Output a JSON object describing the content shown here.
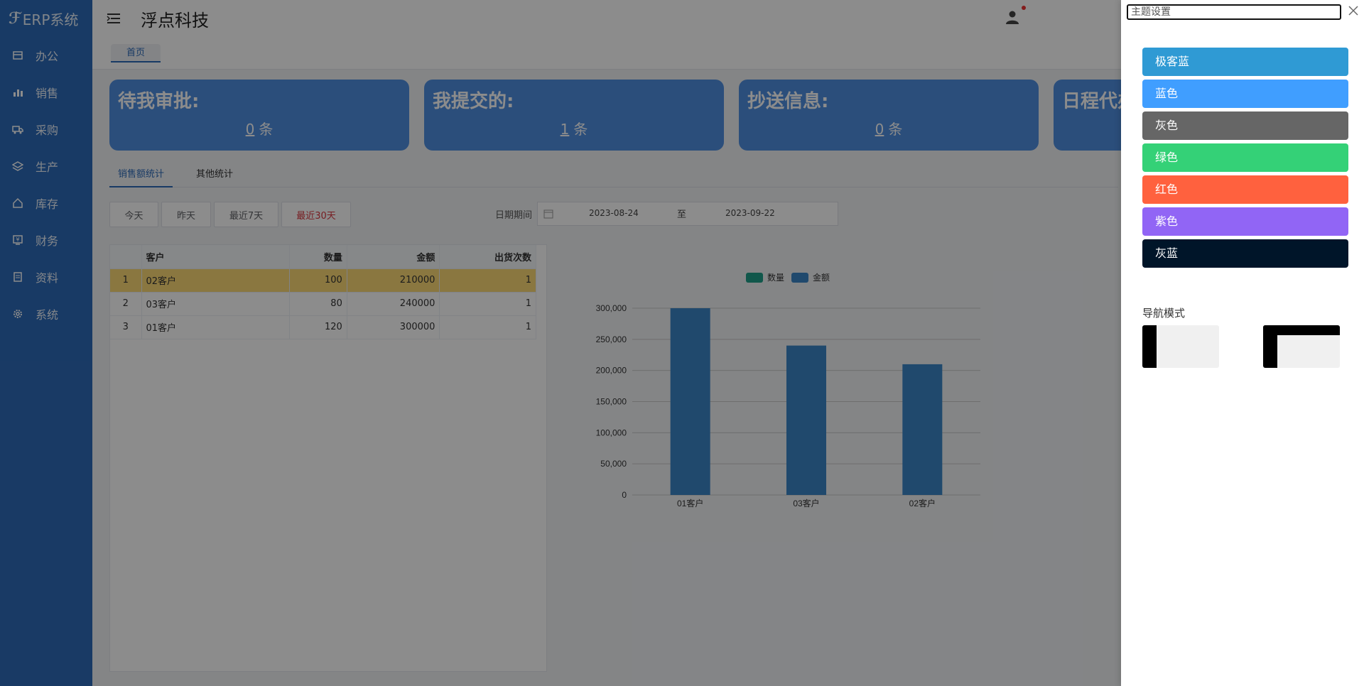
{
  "app": {
    "logo_text": "ERP系统",
    "company": "浮点科技"
  },
  "sidebar": {
    "items": [
      {
        "label": "办公",
        "icon": "office-icon"
      },
      {
        "label": "销售",
        "icon": "bar-chart-icon"
      },
      {
        "label": "采购",
        "icon": "truck-icon"
      },
      {
        "label": "生产",
        "icon": "layers-icon"
      },
      {
        "label": "库存",
        "icon": "home-icon"
      },
      {
        "label": "财务",
        "icon": "finance-icon"
      },
      {
        "label": "资料",
        "icon": "documents-icon"
      },
      {
        "label": "系统",
        "icon": "gear-icon"
      }
    ]
  },
  "tabbar": {
    "home": "首页"
  },
  "cards": [
    {
      "title": "待我审批:",
      "count": "0",
      "unit": "条"
    },
    {
      "title": "我提交的:",
      "count": "1",
      "unit": "条"
    },
    {
      "title": "抄送信息:",
      "count": "0",
      "unit": "条"
    },
    {
      "title": "日程代办",
      "count": "",
      "unit": ""
    }
  ],
  "stat_tabs": [
    "销售额统计",
    "其他统计"
  ],
  "buttons": {
    "today": "今天",
    "yesterday": "昨天",
    "last7": "最近7天",
    "last30": "最近30天"
  },
  "date_filter": {
    "label": "日期期间",
    "start": "2023-08-24",
    "separator": "至",
    "end": "2023-09-22"
  },
  "table": {
    "headers": [
      "",
      "客户",
      "数量",
      "金额",
      "出货次数"
    ],
    "rows": [
      [
        "1",
        "02客户",
        "100",
        "210000",
        "1"
      ],
      [
        "2",
        "03客户",
        "80",
        "240000",
        "1"
      ],
      [
        "3",
        "01客户",
        "120",
        "300000",
        "1"
      ]
    ]
  },
  "chart_data": {
    "type": "bar",
    "categories": [
      "01客户",
      "03客户",
      "02客户"
    ],
    "series": [
      {
        "name": "数量",
        "values": [
          120,
          80,
          100
        ],
        "color": "#1f9e89"
      },
      {
        "name": "金额",
        "values": [
          300000,
          240000,
          210000
        ],
        "color": "#3b86c6"
      }
    ],
    "ylim": [
      0,
      300000
    ],
    "yticks": [
      "300,000",
      "250,000",
      "200,000",
      "150,000",
      "100,000",
      "50,000",
      "0"
    ],
    "legend": "top-center",
    "grid": true
  },
  "drawer": {
    "title": "主题设置",
    "themes": [
      {
        "label": "极客蓝",
        "color": "#2f9ad4"
      },
      {
        "label": "蓝色",
        "color": "#409eff"
      },
      {
        "label": "灰色",
        "color": "#666666"
      },
      {
        "label": "绿色",
        "color": "#34d177"
      },
      {
        "label": "红色",
        "color": "#ff613e"
      },
      {
        "label": "紫色",
        "color": "#9165f5"
      },
      {
        "label": "灰蓝",
        "color": "#001529"
      }
    ],
    "nav_mode_label": "导航模式"
  }
}
